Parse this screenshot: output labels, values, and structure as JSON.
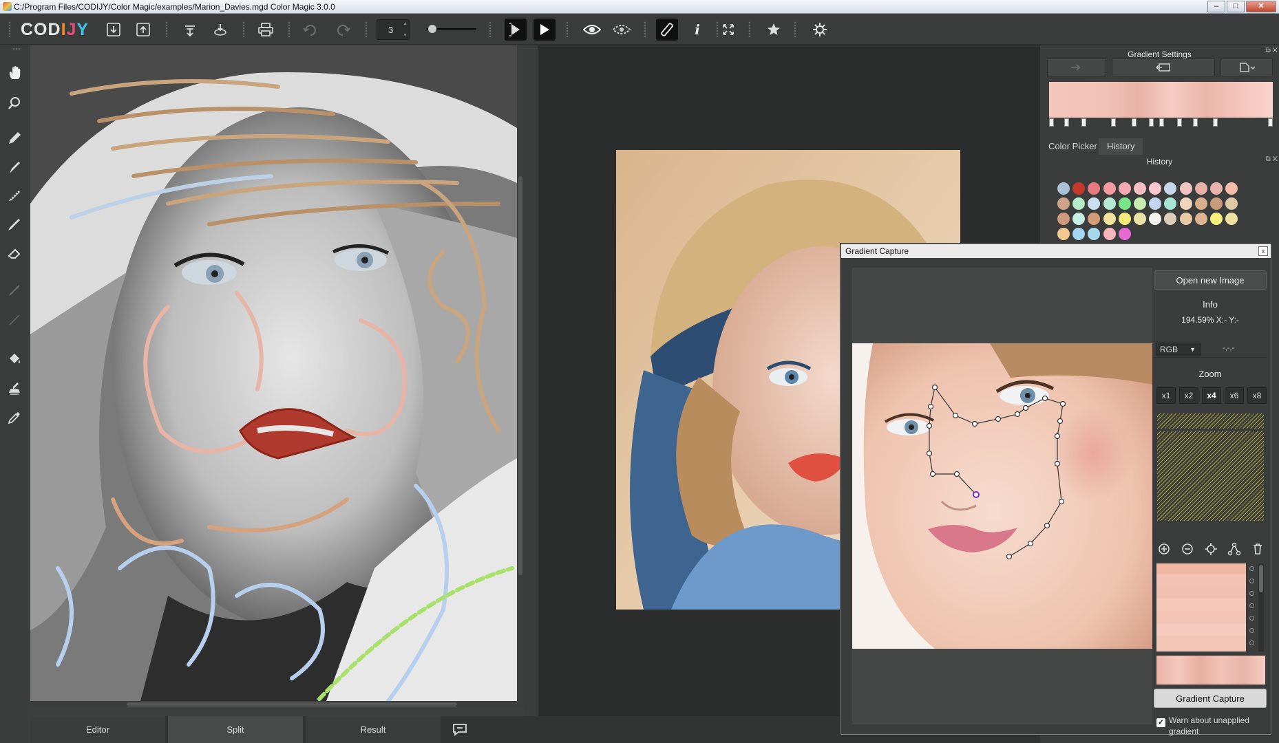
{
  "window": {
    "title": "C:/Program Files/CODIJY/Color Magic/examples/Marion_Davies.mgd Color Magic 3.0.0",
    "min": "–",
    "max": "□",
    "close": "✕"
  },
  "toolbar": {
    "logo": [
      "COD",
      "I",
      "J",
      "Y",
      ""
    ],
    "brush_size": "3"
  },
  "tabs": {
    "editor": "Editor",
    "split": "Split",
    "result": "Result"
  },
  "gradient_settings": {
    "title": "Gradient Settings"
  },
  "palette_tabs": {
    "color_picker": "Color Picker",
    "history": "History"
  },
  "history": {
    "title": "History",
    "swatches": [
      [
        "#a9c2d6",
        "#c33a2a",
        "#e97a80",
        "#f59ca2",
        "#f7a9b1",
        "#f7bcc4",
        "#f9c7cf",
        "#c6d7ea",
        "#f2c7c3",
        "#e9b0a8",
        "#eab2aa",
        "#f5bca8"
      ],
      [
        "#cfa38a",
        "#b6ecc8",
        "#cbe0ef",
        "#b8e9d3",
        "#79e588",
        "#c8ecb0",
        "#c4d4ef",
        "#a6e6d2",
        "#f1d4ba",
        "#d9ae8a",
        "#c89c7a",
        "#dfc9a6"
      ],
      [
        "#cf9a7c",
        "#c7f0e4",
        "#d39c76",
        "#f2e39a",
        "#f1ec7c",
        "#e9e2a6",
        "#f2f2ee",
        "#d8ceba",
        "#e8cba6",
        "#dcb490",
        "#f7f07a",
        "#efe0a2"
      ],
      [
        "#f5c791",
        "#a7d6f1",
        "#a6d9ee",
        "#f5b5ba",
        "#e76ad4"
      ]
    ]
  },
  "capture": {
    "title": "Gradient Capture",
    "close": "x",
    "open_button": "Open new Image",
    "info_label": "Info",
    "info_readout": "194.59% X:- Y:-",
    "color_mode": "RGB",
    "color_values": "-,-,-",
    "zoom_label": "Zoom",
    "zoom_levels": [
      "x1",
      "x2",
      "x4",
      "x6",
      "x8"
    ],
    "capture_button": "Gradient Capture",
    "warn_text": "Warn about unapplied gradient",
    "warn_checked": true
  },
  "icons": [
    "hand-icon",
    "zoom-icon",
    "pencil-icon",
    "brush-icon",
    "spray-icon",
    "marker-icon",
    "eraser-icon",
    "fill-bucket-icon",
    "stamp-icon",
    "eyedropper-icon",
    "save-icon",
    "open-icon",
    "export-icon",
    "print-icon",
    "undo-icon",
    "redo-icon",
    "play-icon",
    "eye-icon",
    "info-icon",
    "fullscreen-icon",
    "star-icon",
    "settings-icon",
    "speech-bubble-icon"
  ]
}
